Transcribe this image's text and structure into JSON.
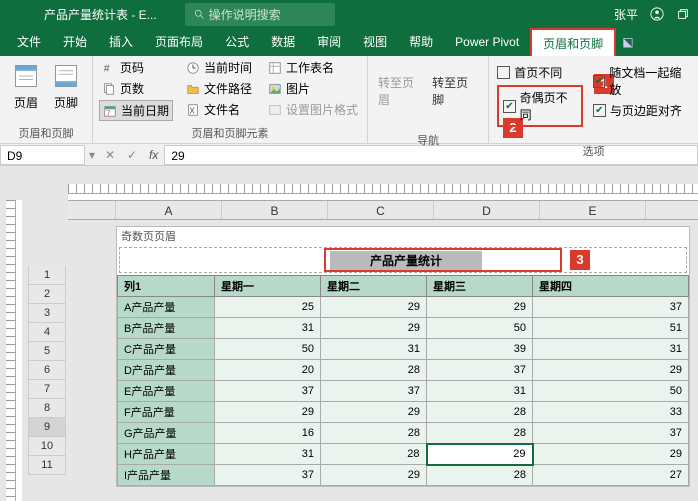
{
  "titlebar": {
    "doc": "产品产量统计表 - E...",
    "search": "操作说明搜索",
    "user": "张平"
  },
  "menu": {
    "items": [
      "文件",
      "开始",
      "插入",
      "页面布局",
      "公式",
      "数据",
      "审阅",
      "视图",
      "帮助",
      "Power Pivot",
      "页眉和页脚"
    ]
  },
  "callouts": {
    "c1": "1",
    "c2": "2",
    "c3": "3"
  },
  "ribbon": {
    "hf": {
      "header": "页眉",
      "footer": "页脚",
      "group": "页眉和页脚"
    },
    "el": {
      "pageno": "页码",
      "pages": "页数",
      "curdate": "当前日期",
      "curtime": "当前时间",
      "filepath": "文件路径",
      "filename": "文件名",
      "sheet": "工作表名",
      "pic": "图片",
      "picfmt": "设置图片格式",
      "group": "页眉和页脚元素"
    },
    "nav": {
      "gohdr": "转至页眉",
      "goftr": "转至页脚",
      "group": "导航"
    },
    "opt": {
      "firstdiff": "首页不同",
      "oddeven": "奇偶页不同",
      "scale": "随文档一起缩放",
      "align": "与页边距对齐",
      "group": "选项"
    }
  },
  "formula": {
    "cell": "D9",
    "value": "29"
  },
  "cols": [
    "A",
    "B",
    "C",
    "D",
    "E"
  ],
  "rows": [
    "1",
    "2",
    "3",
    "4",
    "5",
    "6",
    "7",
    "8",
    "9",
    "10",
    "11"
  ],
  "page": {
    "hdrlabel": "奇数页页眉",
    "title": "产品产量统计"
  },
  "table": {
    "headers": [
      "列1",
      "星期一",
      "星期二",
      "星期三",
      "星期四"
    ],
    "data": [
      {
        "n": "A产品产量",
        "v": [
          25,
          29,
          29,
          37
        ]
      },
      {
        "n": "B产品产量",
        "v": [
          31,
          29,
          50,
          51
        ]
      },
      {
        "n": "C产品产量",
        "v": [
          50,
          31,
          39,
          31
        ]
      },
      {
        "n": "D产品产量",
        "v": [
          20,
          28,
          37,
          29
        ]
      },
      {
        "n": "E产品产量",
        "v": [
          37,
          37,
          31,
          50
        ]
      },
      {
        "n": "F产品产量",
        "v": [
          29,
          29,
          28,
          33
        ]
      },
      {
        "n": "G产品产量",
        "v": [
          16,
          28,
          28,
          37
        ]
      },
      {
        "n": "H产品产量",
        "v": [
          31,
          28,
          29,
          29
        ]
      },
      {
        "n": "I产品产量",
        "v": [
          37,
          29,
          28,
          27
        ]
      }
    ]
  }
}
